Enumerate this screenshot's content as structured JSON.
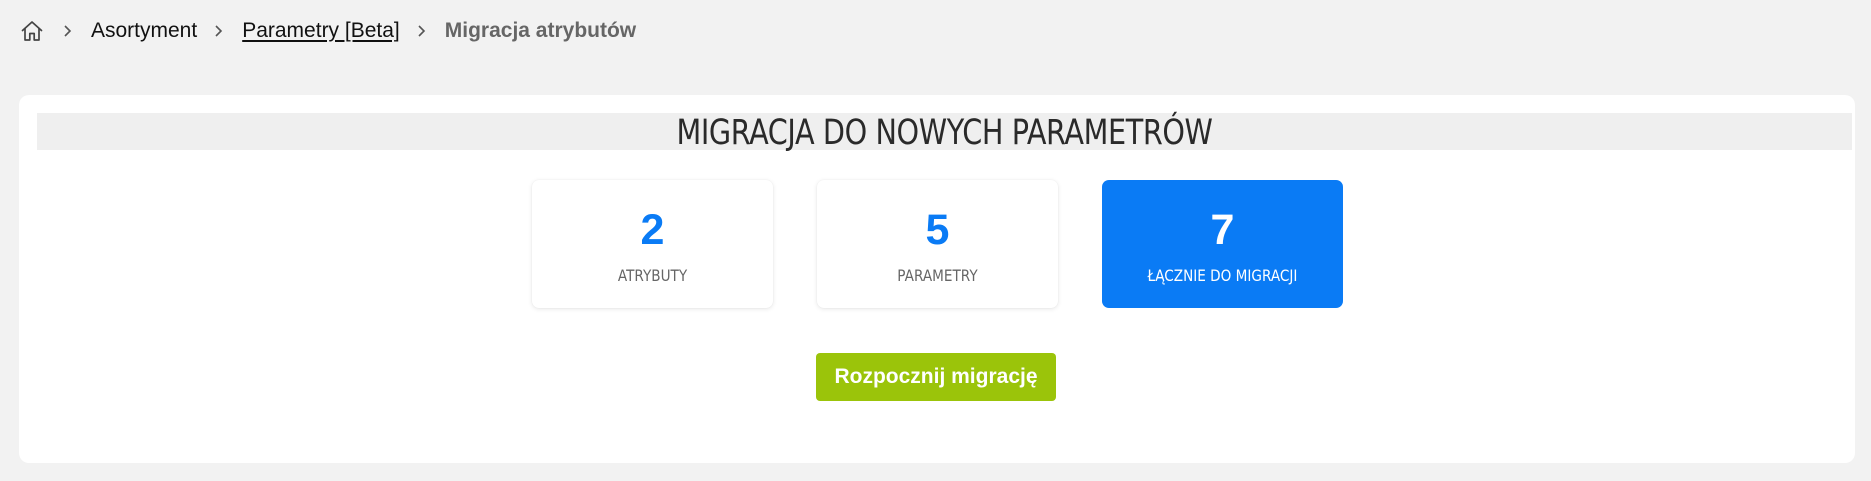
{
  "breadcrumb": {
    "home_icon": "home-icon",
    "separator_icon": "chevron-right-icon",
    "items": [
      {
        "label": "Asortyment"
      },
      {
        "label": "Parametry [Beta]"
      },
      {
        "label": "Migracja atrybutów"
      }
    ]
  },
  "panel": {
    "title": "MIGRACJA DO NOWYCH PARAMETRÓW"
  },
  "stats": [
    {
      "value": "2",
      "label": "ATRYBUTY"
    },
    {
      "value": "5",
      "label": "PARAMETRY"
    },
    {
      "value": "7",
      "label": "ŁĄCZNIE DO MIGRACJI"
    }
  ],
  "actions": {
    "start_label": "Rozpocznij migrację"
  },
  "colors": {
    "background": "#f2f2f2",
    "accent_blue": "#0a7bf5",
    "button_green": "#9bc40a"
  }
}
